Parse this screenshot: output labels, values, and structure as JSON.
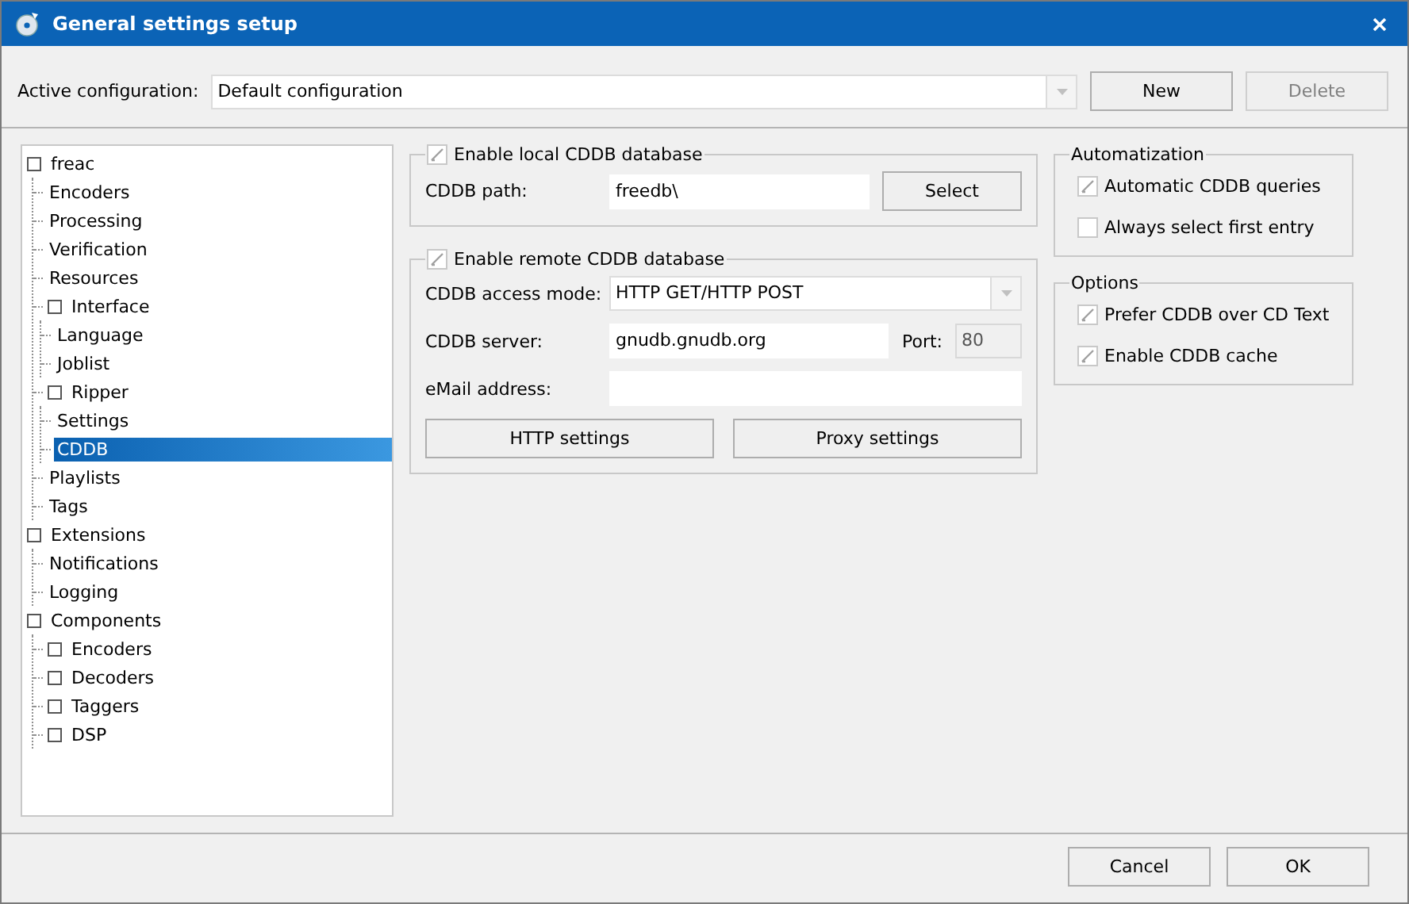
{
  "window": {
    "title": "General settings setup"
  },
  "active_configuration": {
    "label": "Active configuration:",
    "value": "Default configuration"
  },
  "config_buttons": [
    {
      "label": "New",
      "disabled": false
    },
    {
      "label": "Delete",
      "disabled": true
    }
  ],
  "tree": [
    {
      "label": "freac",
      "kind": "group",
      "selected": false,
      "children": [
        {
          "label": "Encoders",
          "kind": "item",
          "selected": false
        },
        {
          "label": "Processing",
          "kind": "item",
          "selected": false
        },
        {
          "label": "Verification",
          "kind": "item",
          "selected": false
        },
        {
          "label": "Resources",
          "kind": "item",
          "selected": false
        },
        {
          "label": "Interface",
          "kind": "group",
          "selected": false,
          "children": [
            {
              "label": "Language",
              "kind": "item",
              "selected": false
            },
            {
              "label": "Joblist",
              "kind": "item",
              "selected": false
            }
          ]
        },
        {
          "label": "Ripper",
          "kind": "group",
          "selected": false,
          "children": [
            {
              "label": "Settings",
              "kind": "item",
              "selected": false
            },
            {
              "label": "CDDB",
              "kind": "item",
              "selected": true
            }
          ]
        },
        {
          "label": "Playlists",
          "kind": "item",
          "selected": false
        },
        {
          "label": "Tags",
          "kind": "item",
          "selected": false
        }
      ]
    },
    {
      "label": "Extensions",
      "kind": "group",
      "selected": false,
      "children": [
        {
          "label": "Notifications",
          "kind": "item",
          "selected": false
        },
        {
          "label": "Logging",
          "kind": "item",
          "selected": false
        }
      ]
    },
    {
      "label": "Components",
      "kind": "group",
      "selected": false,
      "children": [
        {
          "label": "Encoders",
          "kind": "group",
          "selected": false
        },
        {
          "label": "Decoders",
          "kind": "group",
          "selected": false
        },
        {
          "label": "Taggers",
          "kind": "group",
          "selected": false
        },
        {
          "label": "DSP",
          "kind": "group",
          "selected": false
        }
      ]
    }
  ],
  "local_group": {
    "label": "Enable local CDDB database",
    "checked": true,
    "path_label": "CDDB path:",
    "path_value": "freedb\\",
    "select_button": "Select"
  },
  "remote_group": {
    "label": "Enable remote CDDB database",
    "checked": true,
    "access_mode_label": "CDDB access mode:",
    "access_mode_value": "HTTP GET/HTTP POST",
    "server_label": "CDDB server:",
    "server_value": "gnudb.gnudb.org",
    "port_label": "Port:",
    "port_value": "80",
    "email_label": "eMail address:",
    "buttons": [
      "HTTP settings",
      "Proxy settings"
    ]
  },
  "automatization": {
    "title": "Automatization",
    "options": [
      {
        "label": "Automatic CDDB queries",
        "checked": true
      },
      {
        "label": "Always select first entry",
        "checked": false
      }
    ]
  },
  "options": {
    "title": "Options",
    "options": [
      {
        "label": "Prefer CDDB over CD Text",
        "checked": true
      },
      {
        "label": "Enable CDDB cache",
        "checked": true
      }
    ]
  },
  "dialog_buttons": [
    "Cancel",
    "OK"
  ]
}
